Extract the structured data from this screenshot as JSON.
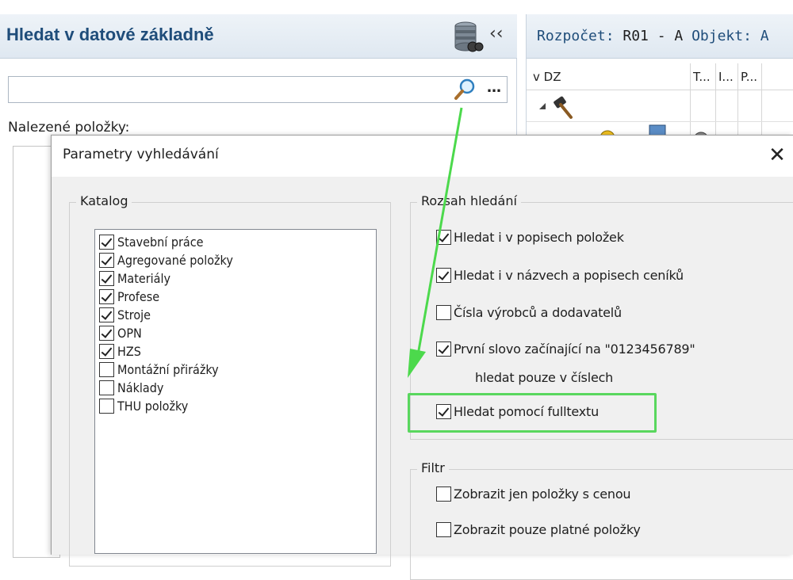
{
  "left_panel": {
    "title": "Hledat v datové základně",
    "search_value": "",
    "found_label": "Nalezené položky:"
  },
  "right_panel": {
    "header_prefix": "Rozpočet: ",
    "header_code": "R01 - A",
    "header_rest": " Objekt: A",
    "columns": [
      "v DZ",
      "T...",
      "I...",
      "P..."
    ]
  },
  "dialog": {
    "title": "Parametry vyhledávání",
    "close_label": "✕",
    "katalog": {
      "legend": "Katalog",
      "items": [
        {
          "label": "Stavební práce",
          "checked": true
        },
        {
          "label": "Agregované položky",
          "checked": true
        },
        {
          "label": "Materiály",
          "checked": true
        },
        {
          "label": "Profese",
          "checked": true
        },
        {
          "label": "Stroje",
          "checked": true
        },
        {
          "label": "OPN",
          "checked": true
        },
        {
          "label": "HZS",
          "checked": true
        },
        {
          "label": "Montážní přirážky",
          "checked": false
        },
        {
          "label": "Náklady",
          "checked": false
        },
        {
          "label": "THU položky",
          "checked": false
        }
      ]
    },
    "range": {
      "legend": "Rozsah hledání",
      "options": [
        {
          "label": "Hledat i v popisech položek",
          "checked": true
        },
        {
          "label": "Hledat i v názvech a popisech ceníků",
          "checked": true
        },
        {
          "label": "Čísla výrobců a dodavatelů",
          "checked": false
        },
        {
          "label": "První slovo začínající na \"0123456789\"",
          "checked": true
        },
        {
          "label": "Hledat pomocí fulltextu",
          "checked": true
        }
      ],
      "option4_line2": "hledat pouze v číslech"
    },
    "filter": {
      "legend": "Filtr",
      "options": [
        {
          "label": "Zobrazit jen položky s cenou",
          "checked": false
        },
        {
          "label": "Zobrazit pouze platné položky",
          "checked": false
        }
      ]
    }
  },
  "colors": {
    "title_blue": "#1f4d7a",
    "highlight_green": "#59d75e",
    "arrow_green": "#4cd94c"
  }
}
